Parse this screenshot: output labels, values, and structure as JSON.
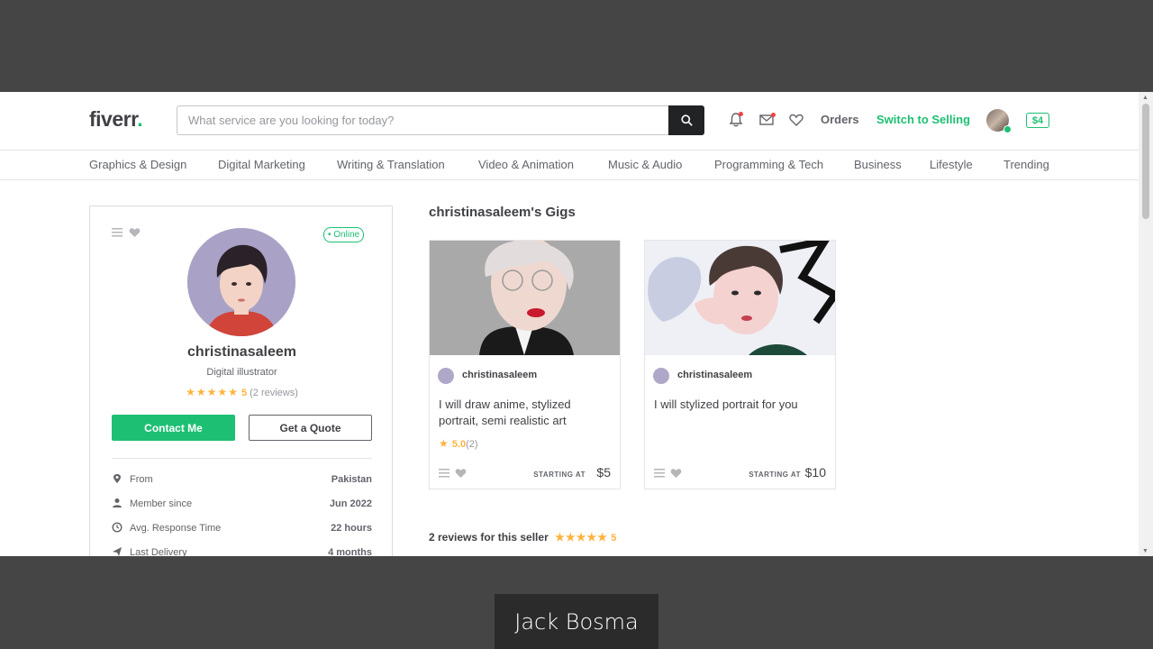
{
  "header": {
    "logo": "fiverr",
    "logo_dot": ".",
    "search_placeholder": "What service are you looking for today?",
    "orders_label": "Orders",
    "switch_label": "Switch to Selling",
    "balance": "$4"
  },
  "nav": {
    "items": [
      "Graphics & Design",
      "Digital Marketing",
      "Writing & Translation",
      "Video & Animation",
      "Music & Audio",
      "Programming & Tech",
      "Business",
      "Lifestyle",
      "Trending"
    ]
  },
  "profile": {
    "status": "• Online",
    "username": "christinasaleem",
    "tagline": "Digital illustrator",
    "stars": "★★★★★",
    "rating": "5",
    "reviews": "(2 reviews)",
    "contact_label": "Contact Me",
    "quote_label": "Get a Quote",
    "stats": [
      {
        "label": "From",
        "value": "Pakistan"
      },
      {
        "label": "Member since",
        "value": "Jun 2022"
      },
      {
        "label": "Avg. Response Time",
        "value": "22 hours"
      },
      {
        "label": "Last Delivery",
        "value": "4 months"
      }
    ]
  },
  "gigs": {
    "title": "christinasaleem's Gigs",
    "starting_label": "STARTING AT",
    "items": [
      {
        "seller": "christinasaleem",
        "description": "I will draw anime, stylized portrait, semi realistic art",
        "rating_star": "★",
        "rating": "5.0",
        "rating_count": "(2)",
        "price": "$5"
      },
      {
        "seller": "christinasaleem",
        "description": "I will stylized portrait for you",
        "price": "$10"
      }
    ]
  },
  "reviews": {
    "heading": "2 reviews for this seller",
    "stars": "★★★★★",
    "rating": "5"
  },
  "caption": "Jack Bosma",
  "colors": {
    "brand": "#1dbf73",
    "star": "#ffb33e",
    "text": "#404145"
  }
}
